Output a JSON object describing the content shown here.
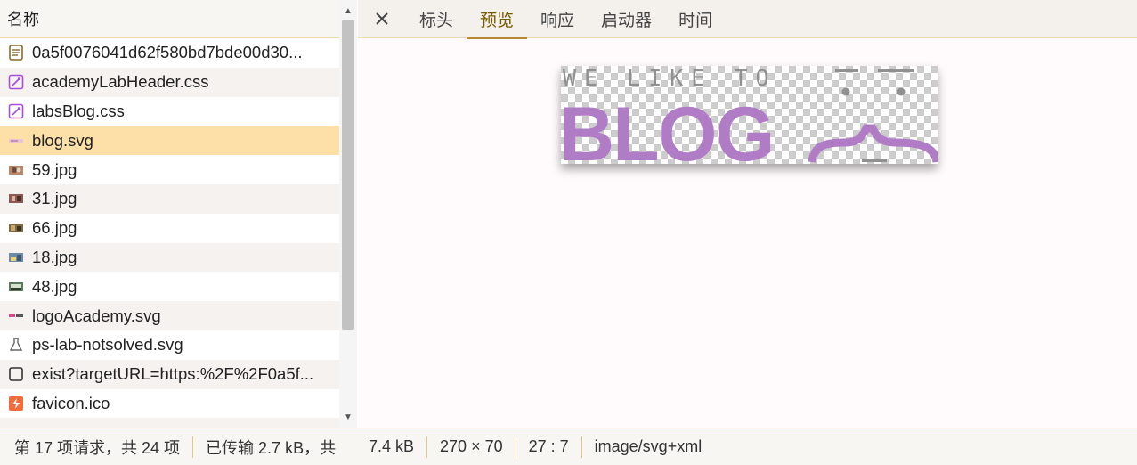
{
  "left_panel": {
    "header": "名称",
    "rows": [
      {
        "name": "0a5f0076041d62f580bd7bde00d30...",
        "icon": "document-icon"
      },
      {
        "name": "academyLabHeader.css",
        "icon": "css-file-icon"
      },
      {
        "name": "labsBlog.css",
        "icon": "css-file-icon"
      },
      {
        "name": "blog.svg",
        "icon": "svg-thumbnail-icon"
      },
      {
        "name": "59.jpg",
        "icon": "image-thumbnail-icon"
      },
      {
        "name": "31.jpg",
        "icon": "image-thumbnail-icon"
      },
      {
        "name": "66.jpg",
        "icon": "image-thumbnail-icon"
      },
      {
        "name": "18.jpg",
        "icon": "image-thumbnail-icon"
      },
      {
        "name": "48.jpg",
        "icon": "image-thumbnail-icon"
      },
      {
        "name": "logoAcademy.svg",
        "icon": "svg-thumbnail-icon"
      },
      {
        "name": "ps-lab-notsolved.svg",
        "icon": "flask-icon"
      },
      {
        "name": "exist?targetURL=https:%2F%2F0a5f...",
        "icon": "blank-file-icon"
      },
      {
        "name": "favicon.ico",
        "icon": "favicon-icon"
      }
    ],
    "selected_index": 3
  },
  "right_panel": {
    "tabs": [
      "标头",
      "预览",
      "响应",
      "启动器",
      "时间"
    ],
    "active_tab": "预览",
    "preview_image": {
      "top_text": "WE LIKE TO",
      "main_text": "BLOG",
      "accent_color": "#b07cc6"
    }
  },
  "footer": {
    "requests": "第 17 项请求，共 24 项",
    "transferred": "已传输 2.7 kB，共",
    "size": "7.4 kB",
    "dimensions": "270 × 70",
    "ratio": "27 : 7",
    "mime": "image/svg+xml"
  },
  "colors": {
    "selected_row": "#fde0a8",
    "border": "#f0d9b2",
    "active_tab_underline": "#b78a2f",
    "css_icon": "#a450d8",
    "favicon": "#f26b3a"
  }
}
